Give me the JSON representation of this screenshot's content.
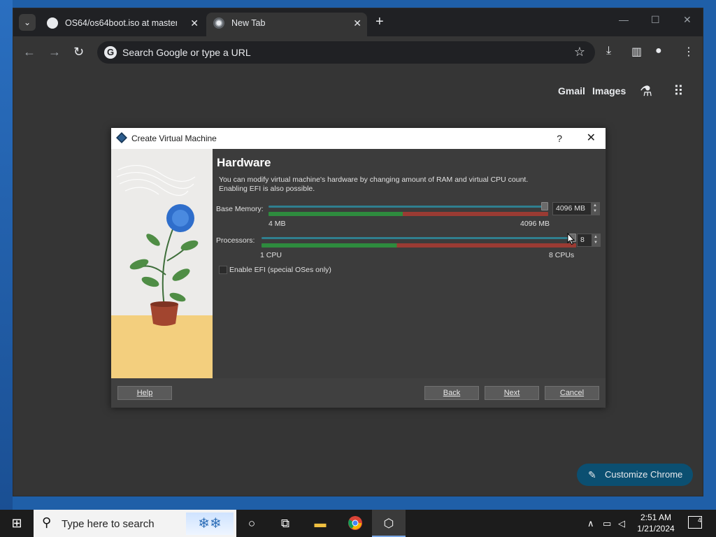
{
  "browser": {
    "tabs": [
      {
        "label": "OS64/os64boot.iso at master · ",
        "close": "✕"
      },
      {
        "label": "New Tab",
        "close": "✕"
      }
    ],
    "new_tab": "+",
    "window_controls": [
      "—",
      "☐",
      "✕"
    ],
    "address_placeholder": "Search Google or type a URL",
    "ntp_links": [
      "Gmail",
      "Images"
    ],
    "customize_label": "Customize Chrome"
  },
  "dialog": {
    "title": "Create Virtual Machine",
    "help_glyph": "?",
    "close_glyph": "✕",
    "heading": "Hardware",
    "description": "You can modify virtual machine's hardware by changing amount of RAM and virtual CPU count. Enabling EFI is also possible.",
    "memory": {
      "label": "Base Memory:",
      "min_label": "4 MB",
      "max_label": "4096 MB",
      "value": "4096 MB",
      "level": 1.0
    },
    "processors": {
      "label": "Processors:",
      "min_label": "1 CPU",
      "max_label": "8 CPUs",
      "value": "8",
      "level": 1.0
    },
    "efi_label": "Enable EFI (special OSes only)",
    "buttons": {
      "help": "Help",
      "back": "Back",
      "next": "Next",
      "cancel": "Cancel"
    }
  },
  "taskbar": {
    "search_placeholder": "Type here to search",
    "time": "2:51 AM",
    "date": "1/21/2024",
    "notifications": "4"
  },
  "colors": {
    "dialog_bg": "#3c3c3c",
    "slider_green": "#2e8b3e",
    "slider_red": "#9a3b33",
    "customize_bg": "#0b4f71"
  }
}
